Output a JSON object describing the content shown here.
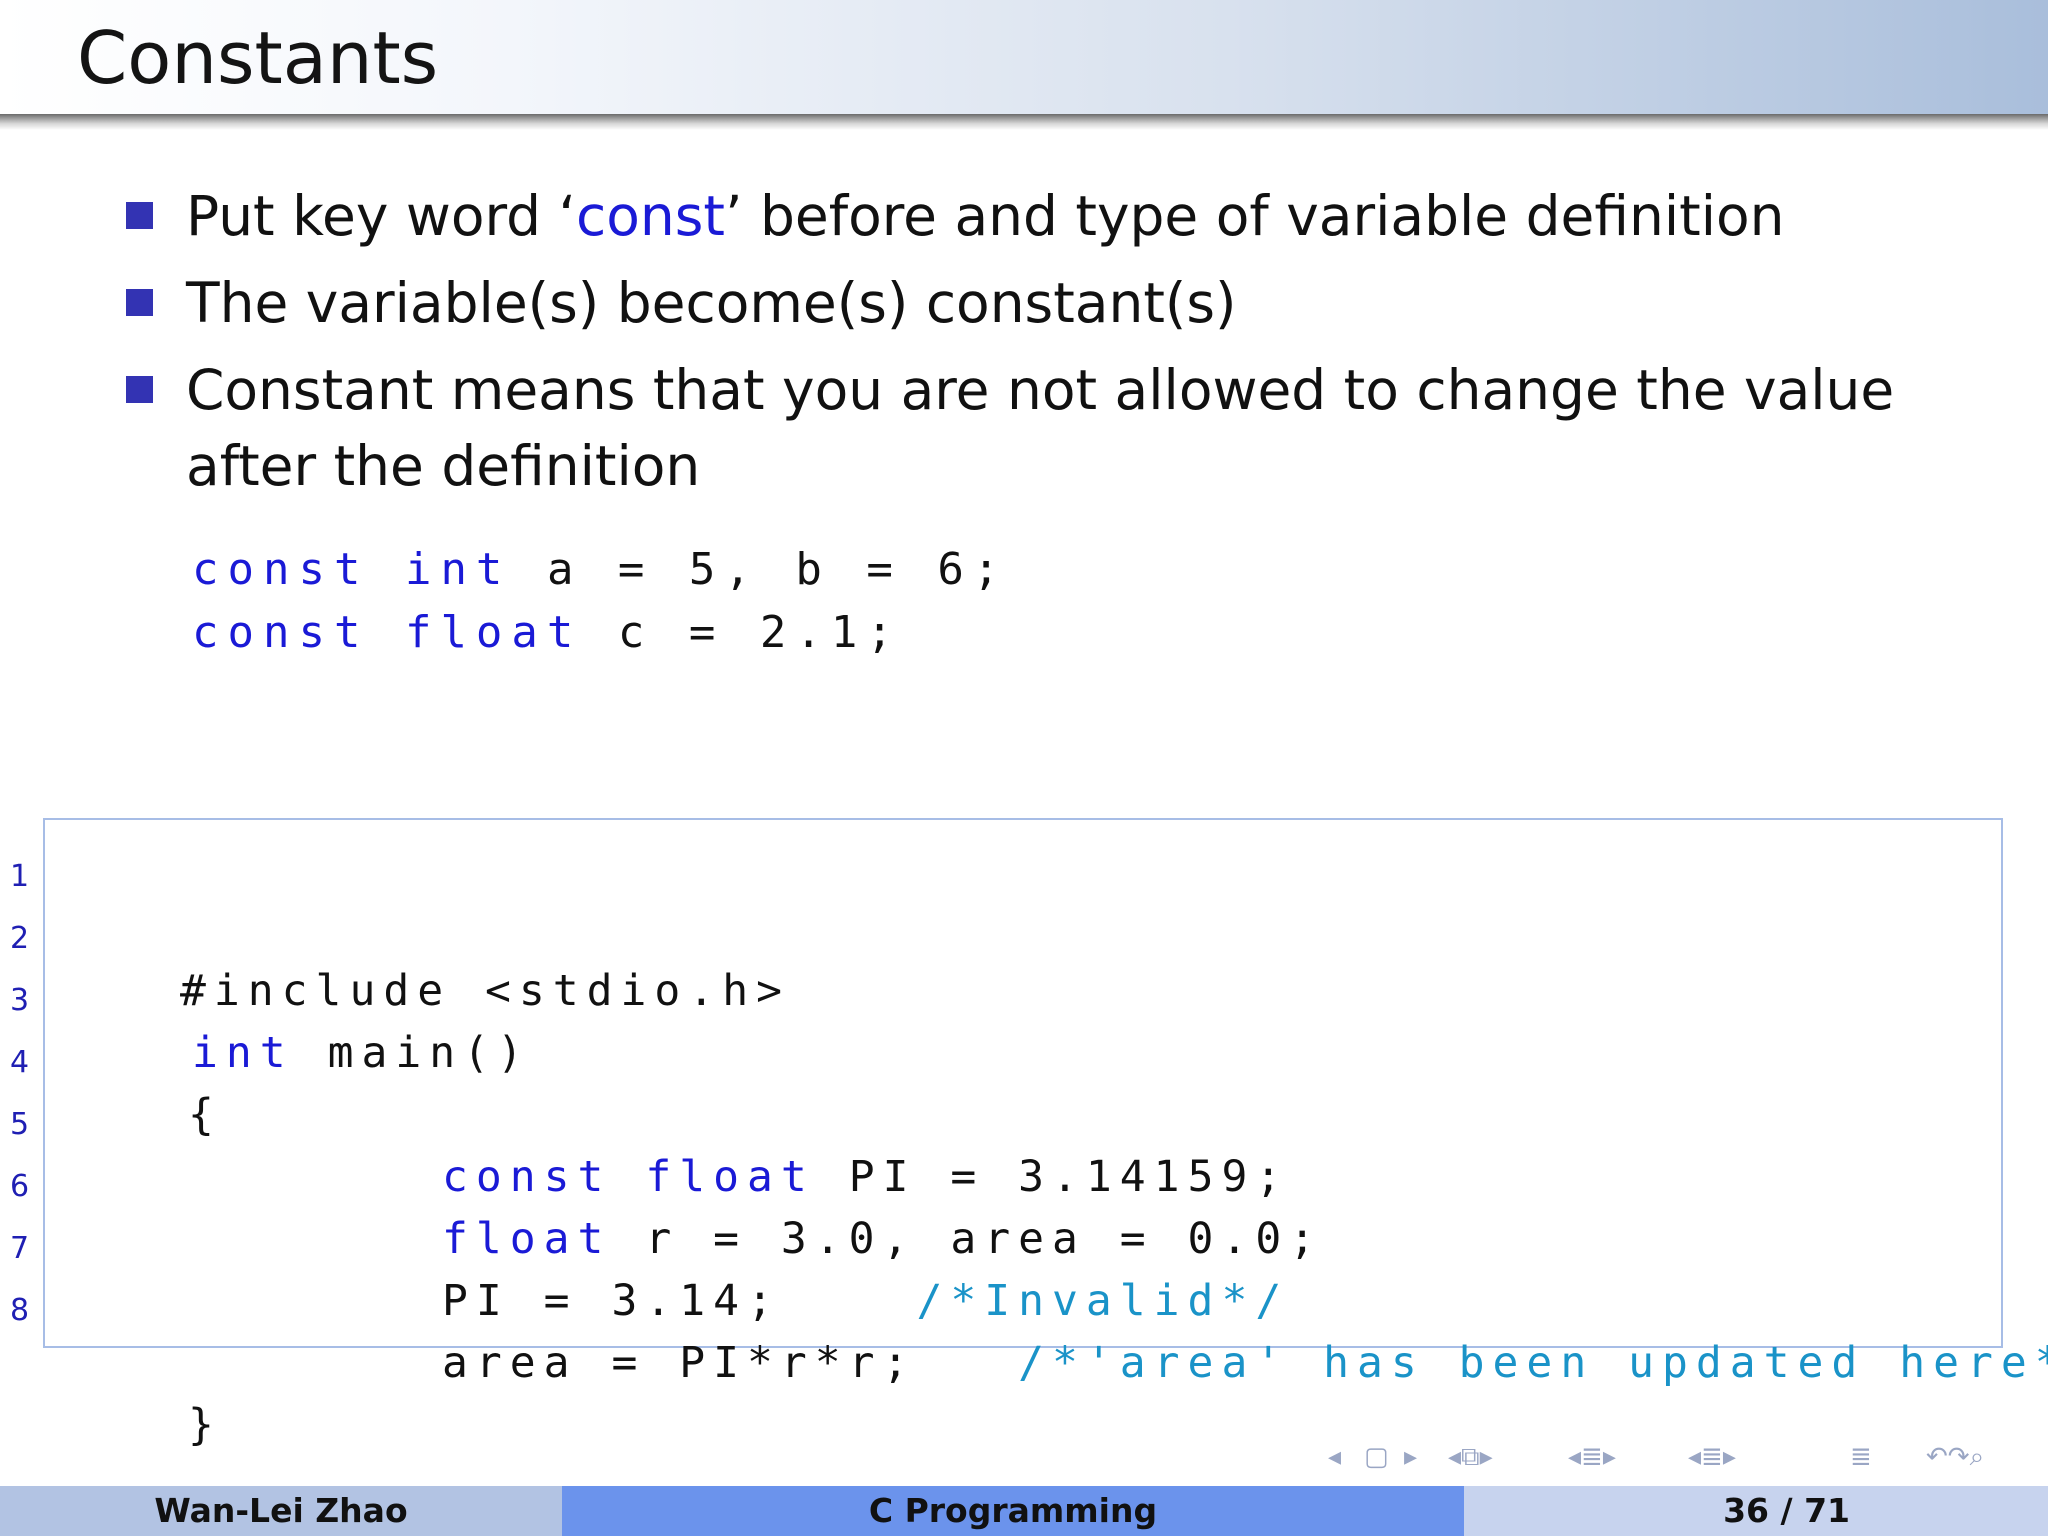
{
  "frame": {
    "title": "Constants"
  },
  "bullets": [
    {
      "before": "Put key word ‘",
      "keyword": "const",
      "after": "’ before and type of variable definition"
    },
    {
      "text": "The variable(s) become(s) constant(s)"
    },
    {
      "text": "Constant means that you are not allowed to change the value after the definition"
    }
  ],
  "inline_code": {
    "line1": {
      "kw1": "const",
      "kw2": "int",
      "rest": "a = 5, b = 6;"
    },
    "line2": {
      "kw1": "const",
      "kw2": "float",
      "rest": "c = 2.1;"
    }
  },
  "listing": {
    "lines": [
      {
        "num": "1",
        "text": "#include <stdio.h>"
      },
      {
        "num": "2",
        "kw": "int",
        "text": "main()"
      },
      {
        "num": "3",
        "text": "{"
      },
      {
        "num": "4",
        "kw1": "const",
        "kw2": "float",
        "text": "PI = 3.14159;"
      },
      {
        "num": "5",
        "kw": "float",
        "text": "r = 3.0, area = 0.0;"
      },
      {
        "num": "6",
        "text": "PI = 3.14;",
        "comment": "/*Invalid*/"
      },
      {
        "num": "7",
        "text": "area = PI*r*r;",
        "comment": "/*'area' has been updated here*/"
      },
      {
        "num": "8",
        "text": "}"
      }
    ]
  },
  "footer": {
    "author": "Wan-Lei Zhao",
    "title": "C Programming",
    "page_current": "36",
    "page_sep": " / ",
    "page_total": "71"
  },
  "nav": {
    "icons": [
      "nav-prev-arrow-icon",
      "frame-icon",
      "nav-next-arrow-icon",
      "subsection-icon",
      "section-icon",
      "document-icon",
      "search-icon",
      "undo-icon"
    ]
  },
  "colors": {
    "bullet": "#3333b3",
    "keyword": "#1a1ad6",
    "comment": "#1a93c8",
    "footer_left": "#b2c3e3",
    "footer_mid": "#6b93ec",
    "footer_right": "#c7d3ee",
    "listing_border": "#a7bde6"
  }
}
